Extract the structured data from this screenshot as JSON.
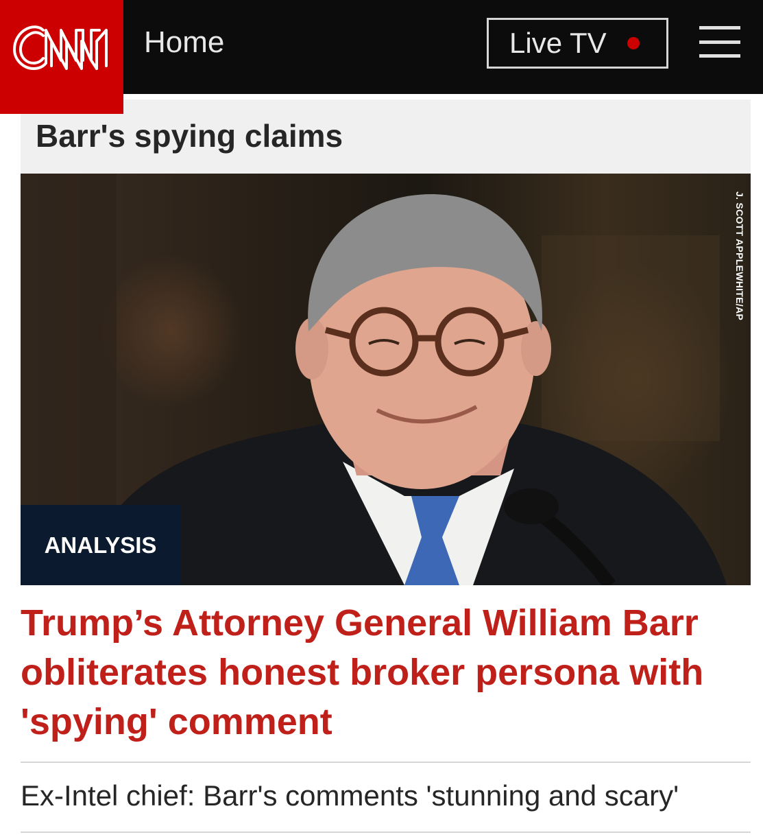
{
  "header": {
    "logo_text": "CNN",
    "home_label": "Home",
    "live_tv_label": "Live TV",
    "brand_color": "#cc0000"
  },
  "section": {
    "title": "Barr's spying claims"
  },
  "hero": {
    "photo_credit": "J. SCOTT APPLEWHITE/AP",
    "badge": "ANALYSIS"
  },
  "article": {
    "headline": "Trump’s Attorney General William Barr obliterates honest broker persona with 'spying' comment",
    "headline_color": "#c0201a"
  },
  "related": {
    "items": [
      {
        "title": "Ex-Intel chief: Barr's comments 'stunning and scary'"
      }
    ]
  },
  "icons": [
    "menu-icon",
    "live-dot-icon"
  ]
}
